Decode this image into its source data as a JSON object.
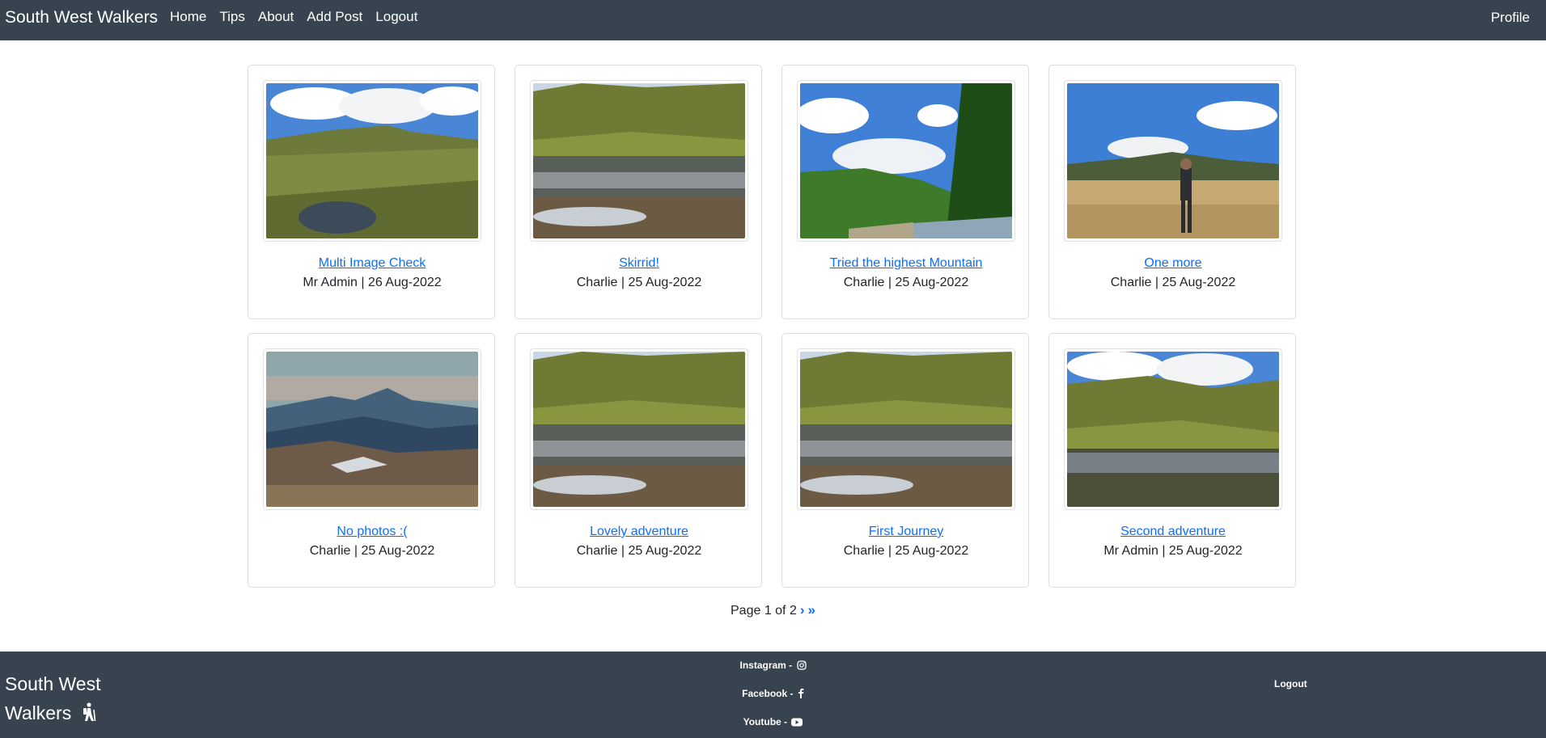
{
  "navbar": {
    "brand": "South West Walkers",
    "links": [
      "Home",
      "Tips",
      "About",
      "Add Post",
      "Logout"
    ],
    "profile": "Profile",
    "background": "#37444f"
  },
  "posts": [
    {
      "title": "Multi Image Check",
      "meta": "Mr Admin | 26 Aug-2022",
      "image": "mountain-lake-clouds"
    },
    {
      "title": "Skirrid!",
      "meta": "Charlie | 25 Aug-2022",
      "image": "valley-lake"
    },
    {
      "title": "Tried the highest Mountain",
      "meta": "Charlie | 25 Aug-2022",
      "image": "river-trees-sky"
    },
    {
      "title": "One more",
      "meta": "Charlie | 25 Aug-2022",
      "image": "hiker-field"
    },
    {
      "title": "No photos :(",
      "meta": "Charlie | 25 Aug-2022",
      "image": "mountain-ranges"
    },
    {
      "title": "Lovely adventure",
      "meta": "Charlie | 25 Aug-2022",
      "image": "valley-lake"
    },
    {
      "title": "First Journey",
      "meta": "Charlie | 25 Aug-2022",
      "image": "valley-lake"
    },
    {
      "title": "Second adventure",
      "meta": "Mr Admin | 25 Aug-2022",
      "image": "valley-lake-clouds"
    }
  ],
  "pagination": {
    "text": "Page 1 of 2",
    "next": "›",
    "last": "»"
  },
  "footer": {
    "brand_line1": "South West",
    "brand_line2": "Walkers",
    "instagram": "Instagram -",
    "facebook": "Facebook -",
    "youtube": "Youtube -",
    "logout": "Logout"
  },
  "colors": {
    "link": "#0d6efd",
    "dark": "#37444f"
  }
}
